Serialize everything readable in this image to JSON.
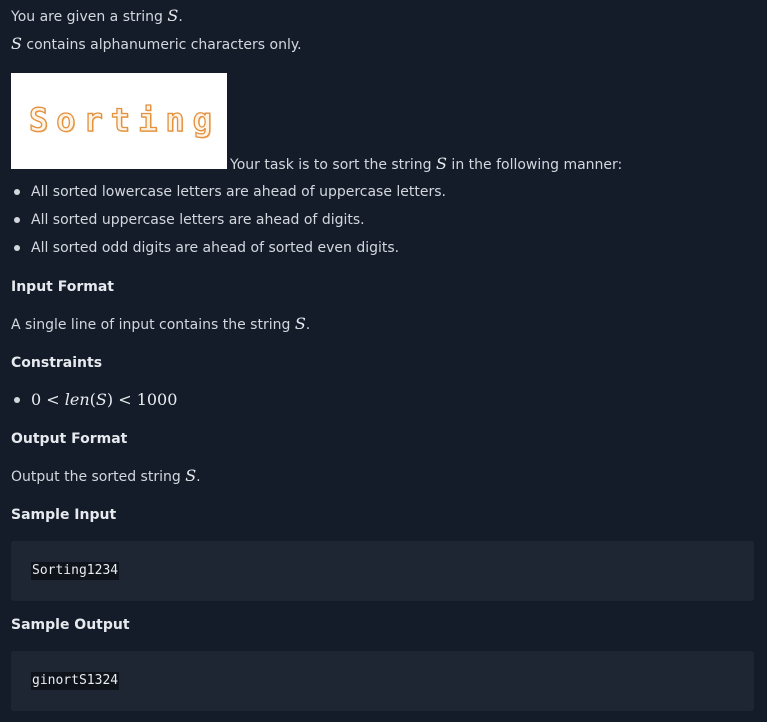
{
  "intro": {
    "line1_prefix": "You are given a string ",
    "line1_var": "S",
    "line1_suffix": ".",
    "line2_var": "S",
    "line2_text": " contains alphanumeric characters only."
  },
  "banner": {
    "text": "Sorting"
  },
  "task": {
    "prefix": "Your task is to sort the string ",
    "var": "S",
    "suffix": " in the following manner:"
  },
  "rules": [
    "All sorted lowercase letters are ahead of uppercase letters.",
    "All sorted uppercase letters are ahead of digits.",
    "All sorted odd digits are ahead of sorted even digits."
  ],
  "input_format": {
    "heading": "Input Format",
    "text_prefix": "A single line of input contains the string ",
    "var": "S",
    "suffix": "."
  },
  "constraints": {
    "heading": "Constraints",
    "expr_a": "0 < ",
    "expr_b": "len",
    "expr_c": "(",
    "expr_d": "S",
    "expr_e": ") < 1000"
  },
  "output_format": {
    "heading": "Output Format",
    "text_prefix": "Output the sorted string ",
    "var": "S",
    "suffix": "."
  },
  "sample_input": {
    "heading": "Sample Input",
    "code": "Sorting1234"
  },
  "sample_output": {
    "heading": "Sample Output",
    "code": "ginortS1324"
  }
}
